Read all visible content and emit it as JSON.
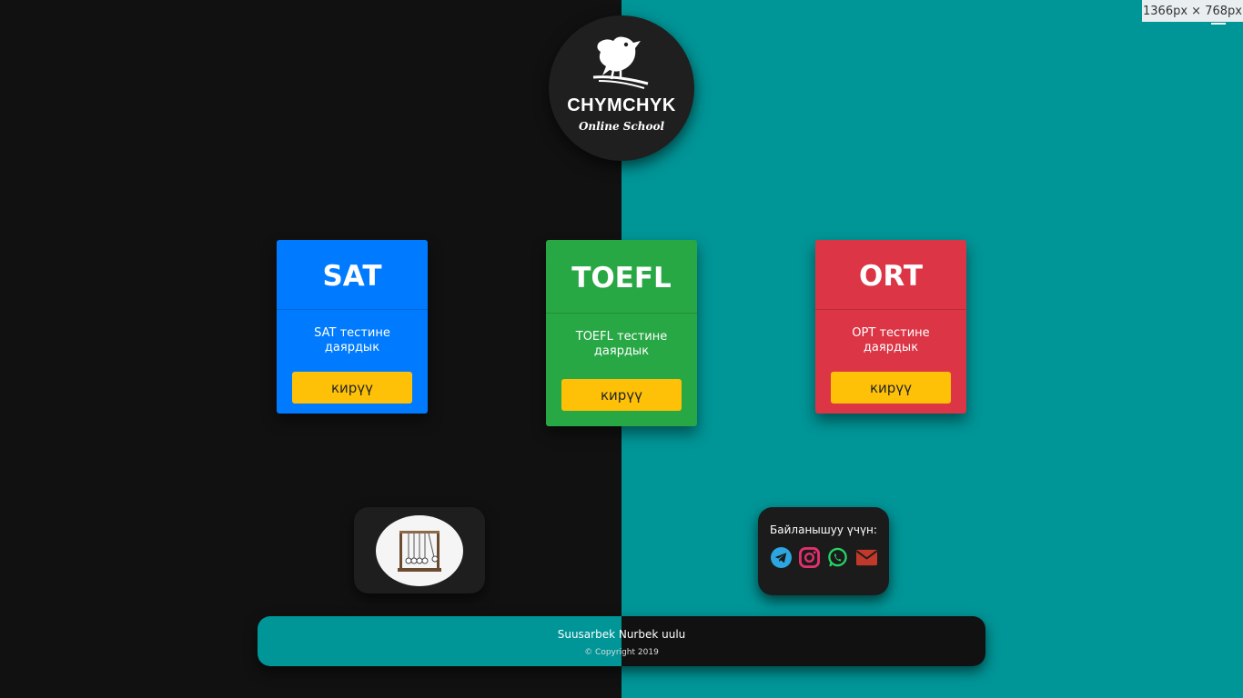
{
  "viewport_badge": "1366px × 768px",
  "logo": {
    "title": "CHYMCHYK",
    "subtitle": "Online School",
    "icon": "bird-icon"
  },
  "cards": [
    {
      "title": "SAT",
      "description": "SAT тестине даярдык",
      "button": "кирүү",
      "color": "#007bff"
    },
    {
      "title": "TOEFL",
      "description": "TOEFL тестине даярдык",
      "button": "кирүү",
      "color": "#28a745"
    },
    {
      "title": "ORT",
      "description": "ОРТ тестине даярдык",
      "button": "кирүү",
      "color": "#dc3545"
    }
  ],
  "pendulum": {
    "icon": "newtons-cradle-icon"
  },
  "contact": {
    "title": "Байланышуу үчүн:",
    "icons": [
      "telegram-icon",
      "instagram-icon",
      "whatsapp-icon",
      "email-icon"
    ]
  },
  "footer": {
    "name": "Suusarbek Nurbek uulu",
    "copyright": "© Copyright 2019"
  },
  "colors": {
    "left_bg": "#111111",
    "right_bg": "#009597",
    "button": "#ffc107"
  }
}
